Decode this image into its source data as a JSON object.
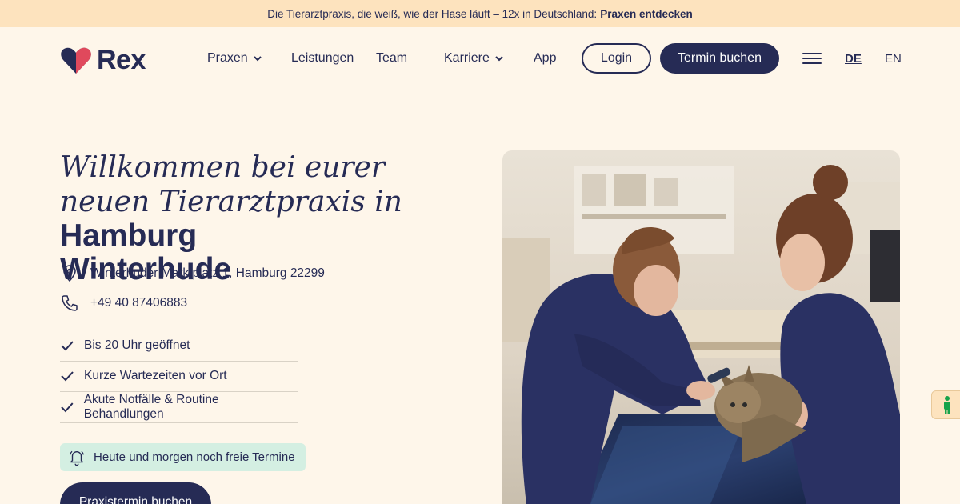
{
  "banner": {
    "text": "Die Tierarztpraxis, die weiß, wie der Hase läuft – 12x in Deutschland:",
    "link": "Praxen entdecken"
  },
  "logo": {
    "word": "Rex",
    "icon": "heart-icon"
  },
  "nav": {
    "items": [
      {
        "label": "Praxen",
        "dropdown": true
      },
      {
        "label": "Leistungen",
        "dropdown": false
      },
      {
        "label": "Team",
        "dropdown": false
      },
      {
        "label": "Karriere",
        "dropdown": true
      },
      {
        "label": "App",
        "dropdown": false
      }
    ],
    "login": "Login",
    "book": "Termin buchen",
    "languages": [
      {
        "code": "DE",
        "active": true
      },
      {
        "code": "EN",
        "active": false
      }
    ]
  },
  "hero": {
    "headline_italic": "Willkommen bei eurer neuen Tierarztpraxis in",
    "headline_bold_1": "Hamburg",
    "headline_bold_2": "Winterhude",
    "address": "Winterhuder Marktplatz 1, Hamburg 22299",
    "phone": "+49 40 87406883",
    "features": [
      "Bis 20 Uhr geöffnet",
      "Kurze Wartezeiten vor Ort",
      "Akute Notfälle & Routine Behandlungen"
    ],
    "availability": "Heute und morgen noch freie Termine",
    "cta": "Praxistermin buchen"
  },
  "colors": {
    "navy": "#262b55",
    "background": "#fef6ea",
    "banner": "#fde3be",
    "heart": "#e0495c",
    "mint": "#d4efe2",
    "scrub": "#2a3163"
  }
}
